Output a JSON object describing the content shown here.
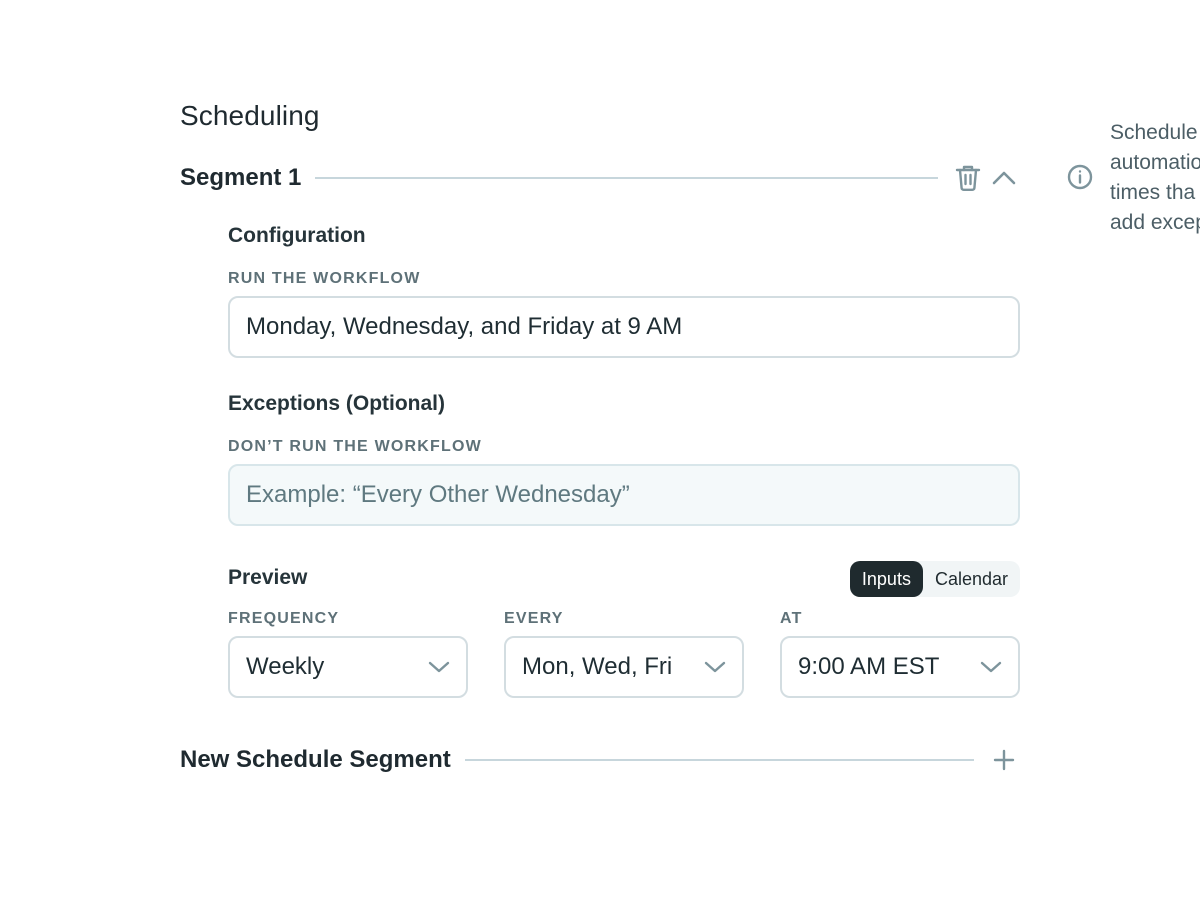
{
  "page": {
    "title": "Scheduling"
  },
  "segment": {
    "title": "Segment 1",
    "configuration": {
      "heading": "Configuration",
      "run_label": "RUN THE WORKFLOW",
      "run_value": "Monday, Wednesday, and Friday at 9 AM"
    },
    "exceptions": {
      "heading": "Exceptions (Optional)",
      "dont_run_label": "DON’T RUN THE WORKFLOW",
      "placeholder": "Example: “Every Other Wednesday”"
    },
    "preview": {
      "heading": "Preview",
      "toggle": {
        "active": "Inputs",
        "inactive": "Calendar"
      },
      "frequency": {
        "label": "FREQUENCY",
        "value": "Weekly"
      },
      "every": {
        "label": "EVERY",
        "value": "Mon, Wed, Fri"
      },
      "at": {
        "label": "AT",
        "value": "9:00 AM EST"
      }
    }
  },
  "new_segment": {
    "label": "New Schedule Segment"
  },
  "side_help": {
    "lines": [
      "Schedule",
      "automatio",
      "times tha",
      "add excep"
    ]
  },
  "colors": {
    "icon": "#7d949c",
    "rule": "#c7d6dc",
    "toggle_active_bg": "#1f2a2e"
  },
  "icons": {
    "delete": "trash-icon",
    "collapse": "chevron-up-icon",
    "info": "info-icon",
    "dropdown": "chevron-down-icon",
    "add": "plus-icon"
  }
}
